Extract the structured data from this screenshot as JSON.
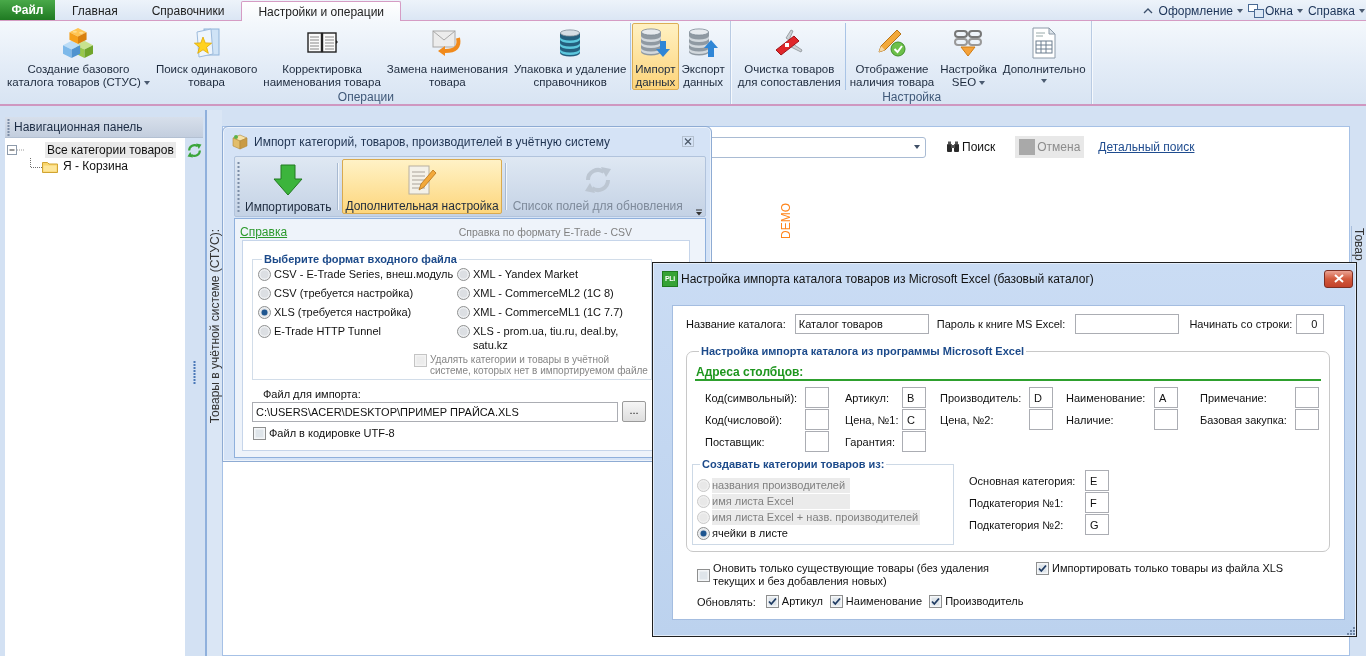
{
  "menu_bar": {
    "tabs": [
      {
        "label": "Файл",
        "kind": "file",
        "selected": false
      },
      {
        "label": "Главная",
        "kind": "tab",
        "selected": false
      },
      {
        "label": "Справочники",
        "kind": "tab",
        "selected": false
      },
      {
        "label": "Настройки и операции",
        "kind": "tab",
        "selected": true
      }
    ],
    "right_menus": [
      {
        "label": "Оформление",
        "kind": "plain"
      },
      {
        "label": "Окна",
        "kind": "windows"
      },
      {
        "label": "Справка",
        "kind": "plain"
      }
    ]
  },
  "ribbon": {
    "groups": [
      {
        "label": "Операции",
        "sections": [
          {
            "buttons": [
              {
                "label": "Создание базового\nкаталога товаров (СТУС)",
                "kind": "blocks",
                "dropdown": true,
                "selected": false
              },
              {
                "label": "Поиск одинакового\nтовара",
                "kind": "star-folder",
                "dropdown": false,
                "selected": false
              },
              {
                "label": "Корректировка\nнаименования товара",
                "kind": "book",
                "dropdown": false,
                "selected": false
              },
              {
                "label": "Замена наименования\nтовара",
                "kind": "envelope-arrow",
                "dropdown": false,
                "selected": false
              },
              {
                "label": "Упаковка и удаление\nсправочников",
                "kind": "database",
                "dropdown": false,
                "selected": false
              }
            ]
          },
          {
            "buttons": [
              {
                "label": "Импорт\nданных",
                "kind": "database-download",
                "dropdown": false,
                "selected": true
              },
              {
                "label": "Экспорт\nданных",
                "kind": "database-upload",
                "dropdown": false,
                "selected": false
              }
            ]
          }
        ]
      },
      {
        "label": "Настройка",
        "sections": [
          {
            "buttons": [
              {
                "label": "Очистка товаров\nдля сопоставления",
                "kind": "pocket-knife",
                "dropdown": false,
                "selected": false
              }
            ]
          },
          {
            "buttons": [
              {
                "label": "Отображение\nналичия товара",
                "kind": "pencil-check",
                "dropdown": false,
                "selected": false
              },
              {
                "label": "Настройка\nSEO",
                "kind": "chain-funnel",
                "dropdown": true,
                "selected": false
              },
              {
                "label": "Дополнительно",
                "kind": "document-table",
                "dropdown": true,
                "selected": false
              }
            ]
          }
        ]
      }
    ]
  },
  "navigation_panel": {
    "title": "Навигационная панель",
    "tree": [
      {
        "label": "Все категории товаров",
        "expanded": true,
        "selected": true,
        "children": [
          {
            "label": "Я - Корзина",
            "selected": false
          }
        ]
      }
    ]
  },
  "products_panel": {
    "tab_label": "Товары в учётной системе (СТУС):",
    "search": {
      "buttons": [
        {
          "label": "Поиск",
          "kind": "search",
          "disabled": false
        },
        {
          "label": "Отмена",
          "kind": "cancel",
          "disabled": true
        }
      ],
      "link": "Детальный поиск"
    },
    "demo_mark": "DEMO",
    "side_tab_label": "Товар"
  },
  "import_dialog": {
    "title": "Импорт категорий, товаров, производителей в учётную систему",
    "toolbar": [
      {
        "label": "Импортировать",
        "kind": "import",
        "selected": false,
        "disabled": false
      },
      {
        "label": "Дополнительная настройка",
        "kind": "settings",
        "selected": true,
        "disabled": false
      },
      {
        "label": "Список полей для обновления",
        "kind": "refresh",
        "selected": false,
        "disabled": true
      }
    ],
    "help_link": "Справка",
    "format_help": "Справка по формату E-Trade - CSV",
    "format_group": {
      "title": "Выберите формат входного файла",
      "options": [
        {
          "label": "CSV - E-Trade Series, внеш.модуль",
          "selected": false
        },
        {
          "label": "CSV (требуется настройка)",
          "selected": false
        },
        {
          "label": "XLS (требуется настройка)",
          "selected": true
        },
        {
          "label": "E-Trade HTTP Tunnel",
          "selected": false
        },
        {
          "label": "XML - Yandex Market",
          "selected": false
        },
        {
          "label": "XML - CommerceML2 (1C 8)",
          "selected": false
        },
        {
          "label": "XML - CommerceML1 (1C 7.7)",
          "selected": false
        },
        {
          "label": "XLS - prom.ua, tiu.ru, deal.by,\nsatu.kz",
          "selected": false
        }
      ],
      "delete_missing": {
        "label": "Удалять категории и товары в учётной\nсистеме, которых нет в импортируемом файле",
        "checked": false,
        "disabled": true
      }
    },
    "file": {
      "label": "Файл для импорта:",
      "value": "C:\\USERS\\ACER\\DESKTOP\\ПРИМЕР ПРАЙСА.XLS",
      "browse": "..."
    },
    "utf8": {
      "label": "Файл в кодировке UTF-8",
      "checked": false
    }
  },
  "excel_dialog": {
    "logo": "PLi",
    "title": "Настройка импорта каталога товаров из Microsoft Excel (базовый каталог)",
    "catalog_name": {
      "label": "Название каталога:",
      "value": "Каталог товаров"
    },
    "password": {
      "label": "Пароль к книге MS Excel:"
    },
    "start_row": {
      "label": "Начинать со строки:",
      "value": "0"
    },
    "settings_group": {
      "title": "Настройка импорта каталога из программы Microsoft Excel",
      "columns_heading": "Адреса столбцов:",
      "columns": [
        {
          "label": "Код(символьный):"
        },
        {
          "label": "Артикул:",
          "value": "B"
        },
        {
          "label": "Производитель:",
          "value": "D"
        },
        {
          "label": "Наименование:",
          "value": "A"
        },
        {
          "label": "Примечание:"
        },
        {
          "label": "Код(числовой):"
        },
        {
          "label": "Цена, №1:",
          "value": "C"
        },
        {
          "label": "Цена, №2:"
        },
        {
          "label": "Наличие:"
        },
        {
          "label": "Базовая закупка:"
        },
        {
          "label": "Поставщик:"
        },
        {
          "label": "Гарантия:"
        }
      ],
      "categories_group": {
        "title": "Создавать категории товаров из:",
        "options": [
          {
            "label": "названия производителей",
            "selected": false,
            "disabled": true
          },
          {
            "label": "имя листа Excel",
            "selected": false,
            "disabled": true
          },
          {
            "label": "имя листа Excel + назв. производителей",
            "selected": false,
            "disabled": true
          },
          {
            "label": "ячейки в листе",
            "selected": true,
            "disabled": false
          }
        ]
      },
      "category_fields": [
        {
          "label": "Основная категория:",
          "value": "E"
        },
        {
          "label": "Подкатегория №1:",
          "value": "F"
        },
        {
          "label": "Подкатегория №2:",
          "value": "G"
        }
      ]
    },
    "options": [
      {
        "label": "Оновить только существующие товары (без удаления\nтекущих и без добавления новых)",
        "checked": false
      },
      {
        "label": "Импортировать только товары из файла XLS",
        "checked": true
      }
    ],
    "update": {
      "label": "Обновлять:",
      "fields": [
        {
          "label": "Артикул",
          "checked": true
        },
        {
          "label": "Наименование",
          "checked": true
        },
        {
          "label": "Производитель",
          "checked": true
        }
      ]
    }
  }
}
